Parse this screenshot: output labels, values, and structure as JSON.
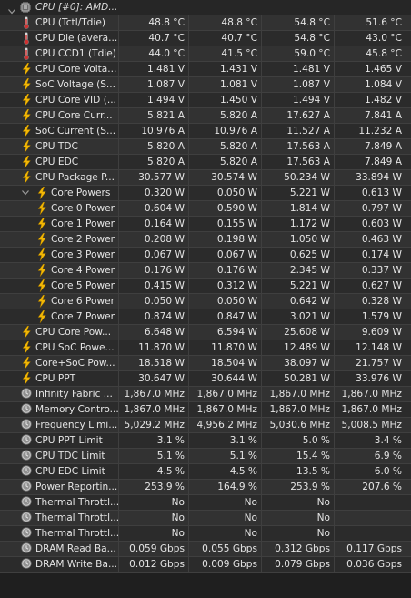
{
  "group": {
    "title": "CPU [#0]: AMD..."
  },
  "sensors": [
    {
      "icon": "thermometer",
      "label": "CPU (Tctl/Tdie)",
      "v": [
        "48.8 °C",
        "48.8 °C",
        "54.8 °C",
        "51.6 °C"
      ]
    },
    {
      "icon": "thermometer",
      "label": "CPU Die (avera...",
      "v": [
        "40.7 °C",
        "40.7 °C",
        "54.8 °C",
        "43.0 °C"
      ]
    },
    {
      "icon": "thermometer",
      "label": "CPU CCD1 (Tdie)",
      "v": [
        "44.0 °C",
        "41.5 °C",
        "59.0 °C",
        "45.8 °C"
      ]
    },
    {
      "icon": "lightning",
      "label": "CPU Core Volta...",
      "v": [
        "1.481 V",
        "1.431 V",
        "1.481 V",
        "1.465 V"
      ]
    },
    {
      "icon": "lightning",
      "label": "SoC Voltage (S...",
      "v": [
        "1.087 V",
        "1.081 V",
        "1.087 V",
        "1.084 V"
      ]
    },
    {
      "icon": "lightning",
      "label": "CPU Core VID (...",
      "v": [
        "1.494 V",
        "1.450 V",
        "1.494 V",
        "1.482 V"
      ]
    },
    {
      "icon": "lightning",
      "label": "CPU Core Curr...",
      "v": [
        "5.821 A",
        "5.820 A",
        "17.627 A",
        "7.841 A"
      ]
    },
    {
      "icon": "lightning",
      "label": "SoC Current (S...",
      "v": [
        "10.976 A",
        "10.976 A",
        "11.527 A",
        "11.232 A"
      ]
    },
    {
      "icon": "lightning",
      "label": "CPU TDC",
      "v": [
        "5.820 A",
        "5.820 A",
        "17.563 A",
        "7.849 A"
      ]
    },
    {
      "icon": "lightning",
      "label": "CPU EDC",
      "v": [
        "5.820 A",
        "5.820 A",
        "17.563 A",
        "7.849 A"
      ]
    },
    {
      "icon": "lightning",
      "label": "CPU Package P...",
      "v": [
        "30.577 W",
        "30.574 W",
        "50.234 W",
        "33.894 W"
      ]
    },
    {
      "icon": "lightning",
      "label": "Core Powers",
      "expander": true,
      "indent": 1,
      "v": [
        "0.320 W",
        "0.050 W",
        "5.221 W",
        "0.613 W"
      ]
    },
    {
      "icon": "lightning",
      "label": "Core 0 Power",
      "indent": 1,
      "v": [
        "0.604 W",
        "0.590 W",
        "1.814 W",
        "0.797 W"
      ]
    },
    {
      "icon": "lightning",
      "label": "Core 1 Power",
      "indent": 1,
      "v": [
        "0.164 W",
        "0.155 W",
        "1.172 W",
        "0.603 W"
      ]
    },
    {
      "icon": "lightning",
      "label": "Core 2 Power",
      "indent": 1,
      "v": [
        "0.208 W",
        "0.198 W",
        "1.050 W",
        "0.463 W"
      ]
    },
    {
      "icon": "lightning",
      "label": "Core 3 Power",
      "indent": 1,
      "v": [
        "0.067 W",
        "0.067 W",
        "0.625 W",
        "0.174 W"
      ]
    },
    {
      "icon": "lightning",
      "label": "Core 4 Power",
      "indent": 1,
      "v": [
        "0.176 W",
        "0.176 W",
        "2.345 W",
        "0.337 W"
      ]
    },
    {
      "icon": "lightning",
      "label": "Core 5 Power",
      "indent": 1,
      "v": [
        "0.415 W",
        "0.312 W",
        "5.221 W",
        "0.627 W"
      ]
    },
    {
      "icon": "lightning",
      "label": "Core 6 Power",
      "indent": 1,
      "v": [
        "0.050 W",
        "0.050 W",
        "0.642 W",
        "0.328 W"
      ]
    },
    {
      "icon": "lightning",
      "label": "Core 7 Power",
      "indent": 1,
      "v": [
        "0.874 W",
        "0.847 W",
        "3.021 W",
        "1.579 W"
      ]
    },
    {
      "icon": "lightning",
      "label": "CPU Core Pow...",
      "v": [
        "6.648 W",
        "6.594 W",
        "25.608 W",
        "9.609 W"
      ]
    },
    {
      "icon": "lightning",
      "label": "CPU SoC Powe...",
      "v": [
        "11.870 W",
        "11.870 W",
        "12.489 W",
        "12.148 W"
      ]
    },
    {
      "icon": "lightning",
      "label": "Core+SoC Pow...",
      "v": [
        "18.518 W",
        "18.504 W",
        "38.097 W",
        "21.757 W"
      ]
    },
    {
      "icon": "lightning",
      "label": "CPU PPT",
      "v": [
        "30.647 W",
        "30.644 W",
        "50.281 W",
        "33.976 W"
      ]
    },
    {
      "icon": "clock",
      "label": "Infinity Fabric ...",
      "v": [
        "1,867.0 MHz",
        "1,867.0 MHz",
        "1,867.0 MHz",
        "1,867.0 MHz"
      ]
    },
    {
      "icon": "clock",
      "label": "Memory Contro...",
      "v": [
        "1,867.0 MHz",
        "1,867.0 MHz",
        "1,867.0 MHz",
        "1,867.0 MHz"
      ]
    },
    {
      "icon": "clock",
      "label": "Frequency Limi...",
      "v": [
        "5,029.2 MHz",
        "4,956.2 MHz",
        "5,030.6 MHz",
        "5,008.5 MHz"
      ]
    },
    {
      "icon": "clock",
      "label": "CPU PPT Limit",
      "v": [
        "3.1 %",
        "3.1 %",
        "5.0 %",
        "3.4 %"
      ]
    },
    {
      "icon": "clock",
      "label": "CPU TDC Limit",
      "v": [
        "5.1 %",
        "5.1 %",
        "15.4 %",
        "6.9 %"
      ]
    },
    {
      "icon": "clock",
      "label": "CPU EDC Limit",
      "v": [
        "4.5 %",
        "4.5 %",
        "13.5 %",
        "6.0 %"
      ]
    },
    {
      "icon": "clock",
      "label": "Power Reportin...",
      "v": [
        "253.9 %",
        "164.9 %",
        "253.9 %",
        "207.6 %"
      ]
    },
    {
      "icon": "clock",
      "label": "Thermal Throttl...",
      "v": [
        "No",
        "No",
        "No",
        ""
      ]
    },
    {
      "icon": "clock",
      "label": "Thermal Throttl...",
      "v": [
        "No",
        "No",
        "No",
        ""
      ]
    },
    {
      "icon": "clock",
      "label": "Thermal Throttl...",
      "v": [
        "No",
        "No",
        "No",
        ""
      ]
    },
    {
      "icon": "clock",
      "label": "DRAM Read Ba...",
      "v": [
        "0.059 Gbps",
        "0.055 Gbps",
        "0.312 Gbps",
        "0.117 Gbps"
      ]
    },
    {
      "icon": "clock",
      "label": "DRAM Write Ba...",
      "v": [
        "0.012 Gbps",
        "0.009 Gbps",
        "0.079 Gbps",
        "0.036 Gbps"
      ]
    }
  ]
}
